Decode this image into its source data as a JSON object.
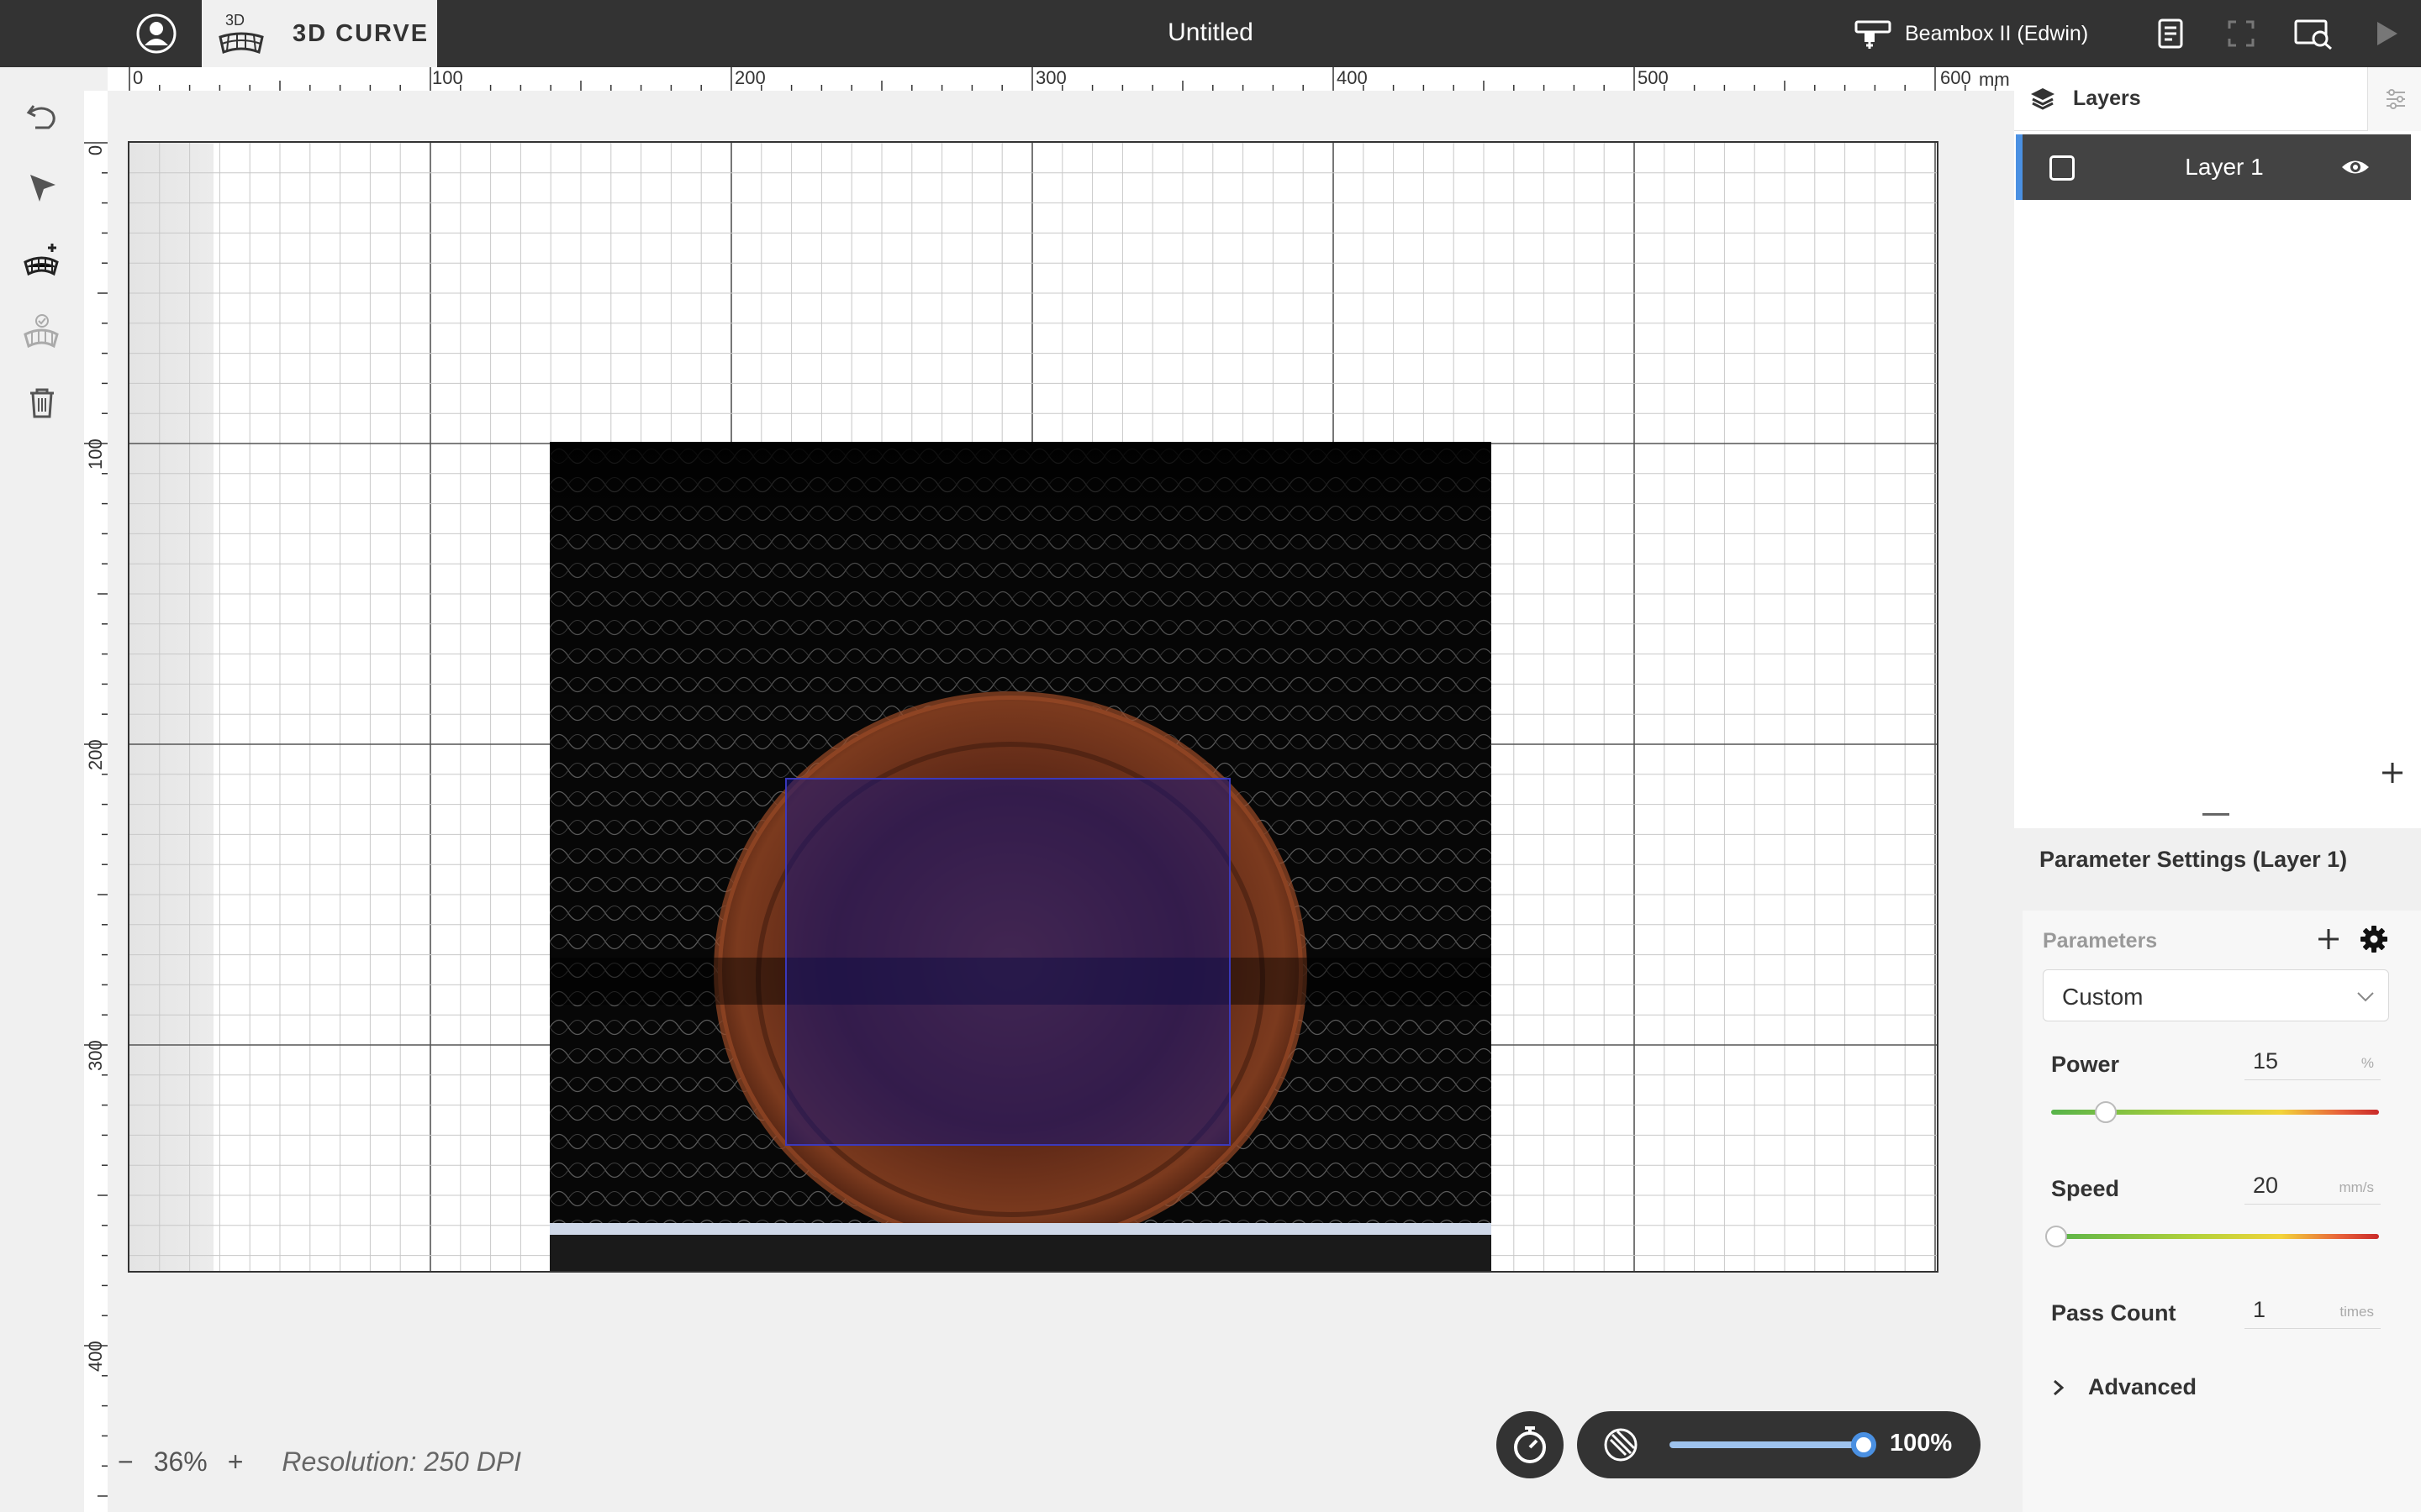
{
  "topbar": {
    "mode_label": "3D CURVE",
    "mode_icon_text": "3D",
    "document_title": "Untitled",
    "machine_name": "Beambox II (Edwin)"
  },
  "ruler": {
    "unit": "mm",
    "h_labels": [
      "0",
      "100",
      "200",
      "300",
      "400",
      "500",
      "600"
    ],
    "v_labels": [
      "0",
      "100",
      "200",
      "300",
      "400"
    ]
  },
  "canvas": {
    "zoom_minus": "−",
    "zoom": "36%",
    "zoom_plus": "+",
    "resolution": "Resolution: 250 DPI",
    "opacity": "100%"
  },
  "layers": {
    "tab_label": "Layers",
    "items": [
      {
        "name": "Layer 1",
        "visible": true
      }
    ]
  },
  "params": {
    "title": "Parameter Settings (Layer 1)",
    "section_label": "Parameters",
    "preset": "Custom",
    "power": {
      "label": "Power",
      "value": "15",
      "unit": "%",
      "fraction": 0.15
    },
    "speed": {
      "label": "Speed",
      "value": "20",
      "unit": "mm/s",
      "fraction": 0.0
    },
    "pass_count": {
      "label": "Pass Count",
      "value": "1",
      "unit": "times"
    },
    "advanced_label": "Advanced"
  },
  "colors": {
    "topbar": "#333333",
    "accent": "#4a90e2",
    "layer_selected": "#434343"
  }
}
